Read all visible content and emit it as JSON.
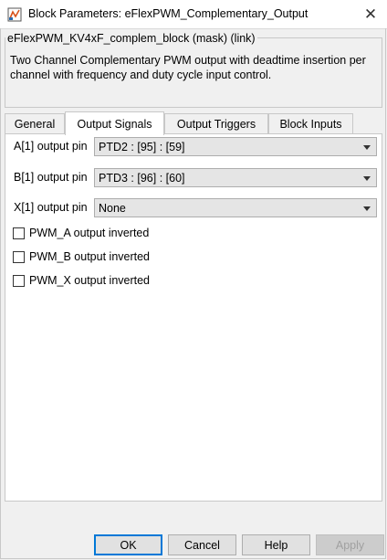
{
  "window": {
    "title": "Block Parameters: eFlexPWM_Complementary_Output",
    "icons": {
      "app": "simulink-block-icon",
      "close": "close-icon"
    }
  },
  "description": {
    "legend": "eFlexPWM_KV4xF_complem_block (mask) (link)",
    "text": "Two Channel Complementary PWM output with deadtime insertion per channel with frequency and duty cycle input control."
  },
  "tabs": [
    {
      "label": "General",
      "active": false
    },
    {
      "label": "Output Signals",
      "active": true
    },
    {
      "label": "Output Triggers",
      "active": false
    },
    {
      "label": "Block Inputs",
      "active": false
    }
  ],
  "fields": [
    {
      "label": "A[1] output pin",
      "value": "PTD2 : [95] : [59]"
    },
    {
      "label": "B[1] output pin",
      "value": "PTD3 : [96] : [60]"
    },
    {
      "label": "X[1] output pin",
      "value": "None"
    }
  ],
  "checkboxes": [
    {
      "label": "PWM_A output inverted",
      "checked": false
    },
    {
      "label": "PWM_B output inverted",
      "checked": false
    },
    {
      "label": "PWM_X output inverted",
      "checked": false
    }
  ],
  "buttons": {
    "ok": "OK",
    "cancel": "Cancel",
    "help": "Help",
    "apply": "Apply"
  },
  "colors": {
    "focus_border": "#0078d7",
    "panel_bg": "#ffffff",
    "dialog_bg": "#f0f0f0"
  }
}
